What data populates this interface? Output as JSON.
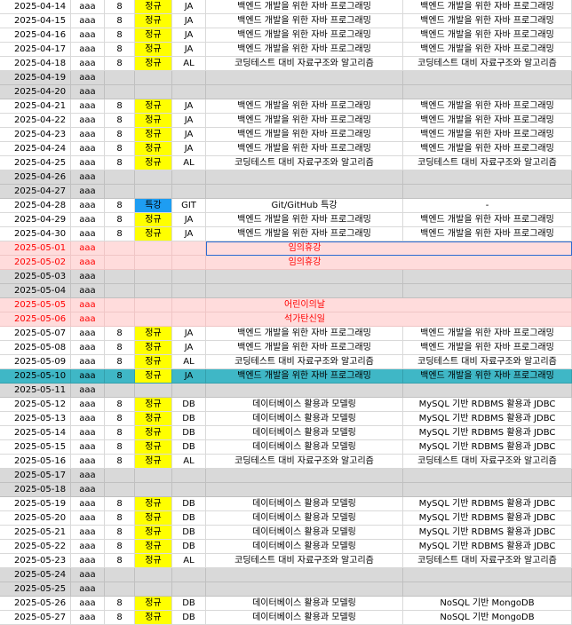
{
  "rows": [
    {
      "date": "2025-04-14",
      "user": "aaa",
      "num": "8",
      "type": "정규",
      "code": "JA",
      "subject": "백엔드 개발을 위한 자바 프로그래밍",
      "detail": "백엔드 개발을 위한 자바 프로그래밍",
      "style": "normal"
    },
    {
      "date": "2025-04-15",
      "user": "aaa",
      "num": "8",
      "type": "정규",
      "code": "JA",
      "subject": "백엔드 개발을 위한 자바 프로그래밍",
      "detail": "백엔드 개발을 위한 자바 프로그래밍",
      "style": "normal"
    },
    {
      "date": "2025-04-16",
      "user": "aaa",
      "num": "8",
      "type": "정규",
      "code": "JA",
      "subject": "백엔드 개발을 위한 자바 프로그래밍",
      "detail": "백엔드 개발을 위한 자바 프로그래밍",
      "style": "normal"
    },
    {
      "date": "2025-04-17",
      "user": "aaa",
      "num": "8",
      "type": "정규",
      "code": "JA",
      "subject": "백엔드 개발을 위한 자바 프로그래밍",
      "detail": "백엔드 개발을 위한 자바 프로그래밍",
      "style": "normal"
    },
    {
      "date": "2025-04-18",
      "user": "aaa",
      "num": "8",
      "type": "정규",
      "code": "AL",
      "subject": "코딩테스트 대비 자료구조와 알고리즘",
      "detail": "코딩테스트 대비 자료구조와 알고리즘",
      "style": "normal"
    },
    {
      "date": "2025-04-19",
      "user": "aaa",
      "num": "",
      "type": "",
      "code": "",
      "subject": "",
      "detail": "",
      "style": "gray"
    },
    {
      "date": "2025-04-20",
      "user": "aaa",
      "num": "",
      "type": "",
      "code": "",
      "subject": "",
      "detail": "",
      "style": "gray"
    },
    {
      "date": "2025-04-21",
      "user": "aaa",
      "num": "8",
      "type": "정규",
      "code": "JA",
      "subject": "백엔드 개발을 위한 자바 프로그래밍",
      "detail": "백엔드 개발을 위한 자바 프로그래밍",
      "style": "normal"
    },
    {
      "date": "2025-04-22",
      "user": "aaa",
      "num": "8",
      "type": "정규",
      "code": "JA",
      "subject": "백엔드 개발을 위한 자바 프로그래밍",
      "detail": "백엔드 개발을 위한 자바 프로그래밍",
      "style": "normal"
    },
    {
      "date": "2025-04-23",
      "user": "aaa",
      "num": "8",
      "type": "정규",
      "code": "JA",
      "subject": "백엔드 개발을 위한 자바 프로그래밍",
      "detail": "백엔드 개발을 위한 자바 프로그래밍",
      "style": "normal"
    },
    {
      "date": "2025-04-24",
      "user": "aaa",
      "num": "8",
      "type": "정규",
      "code": "JA",
      "subject": "백엔드 개발을 위한 자바 프로그래밍",
      "detail": "백엔드 개발을 위한 자바 프로그래밍",
      "style": "normal"
    },
    {
      "date": "2025-04-25",
      "user": "aaa",
      "num": "8",
      "type": "정규",
      "code": "AL",
      "subject": "코딩테스트 대비 자료구조와 알고리즘",
      "detail": "코딩테스트 대비 자료구조와 알고리즘",
      "style": "normal"
    },
    {
      "date": "2025-04-26",
      "user": "aaa",
      "num": "",
      "type": "",
      "code": "",
      "subject": "",
      "detail": "",
      "style": "gray"
    },
    {
      "date": "2025-04-27",
      "user": "aaa",
      "num": "",
      "type": "",
      "code": "",
      "subject": "",
      "detail": "",
      "style": "gray"
    },
    {
      "date": "2025-04-28",
      "user": "aaa",
      "num": "8",
      "type": "특강",
      "code": "GIT",
      "subject": "Git/GitHub 특강",
      "detail": "-",
      "style": "special"
    },
    {
      "date": "2025-04-29",
      "user": "aaa",
      "num": "8",
      "type": "정규",
      "code": "JA",
      "subject": "백엔드 개발을 위한 자바 프로그래밍",
      "detail": "백엔드 개발을 위한 자바 프로그래밍",
      "style": "normal"
    },
    {
      "date": "2025-04-30",
      "user": "aaa",
      "num": "8",
      "type": "정규",
      "code": "JA",
      "subject": "백엔드 개발을 위한 자바 프로그래밍",
      "detail": "백엔드 개발을 위한 자바 프로그래밍",
      "style": "normal"
    },
    {
      "date": "2025-05-01",
      "user": "aaa",
      "num": "",
      "type": "",
      "code": "",
      "subject": "임의휴강",
      "detail": "",
      "style": "pink",
      "selected": true
    },
    {
      "date": "2025-05-02",
      "user": "aaa",
      "num": "",
      "type": "",
      "code": "",
      "subject": "임의휴강",
      "detail": "",
      "style": "pink"
    },
    {
      "date": "2025-05-03",
      "user": "aaa",
      "num": "",
      "type": "",
      "code": "",
      "subject": "",
      "detail": "",
      "style": "gray"
    },
    {
      "date": "2025-05-04",
      "user": "aaa",
      "num": "",
      "type": "",
      "code": "",
      "subject": "",
      "detail": "",
      "style": "gray"
    },
    {
      "date": "2025-05-05",
      "user": "aaa",
      "num": "",
      "type": "",
      "code": "",
      "subject": "어린이의날",
      "detail": "",
      "style": "pink"
    },
    {
      "date": "2025-05-06",
      "user": "aaa",
      "num": "",
      "type": "",
      "code": "",
      "subject": "석가탄신일",
      "detail": "",
      "style": "pink"
    },
    {
      "date": "2025-05-07",
      "user": "aaa",
      "num": "8",
      "type": "정규",
      "code": "JA",
      "subject": "백엔드 개발을 위한 자바 프로그래밍",
      "detail": "백엔드 개발을 위한 자바 프로그래밍",
      "style": "normal"
    },
    {
      "date": "2025-05-08",
      "user": "aaa",
      "num": "8",
      "type": "정규",
      "code": "JA",
      "subject": "백엔드 개발을 위한 자바 프로그래밍",
      "detail": "백엔드 개발을 위한 자바 프로그래밍",
      "style": "normal"
    },
    {
      "date": "2025-05-09",
      "user": "aaa",
      "num": "8",
      "type": "정규",
      "code": "AL",
      "subject": "코딩테스트 대비 자료구조와 알고리즘",
      "detail": "코딩테스트 대비 자료구조와 알고리즘",
      "style": "normal"
    },
    {
      "date": "2025-05-10",
      "user": "aaa",
      "num": "8",
      "type": "정규",
      "code": "JA",
      "subject": "백엔드 개발을 위한 자바 프로그래밍",
      "detail": "백엔드 개발을 위한 자바 프로그래밍",
      "style": "cyan"
    },
    {
      "date": "2025-05-11",
      "user": "aaa",
      "num": "",
      "type": "",
      "code": "",
      "subject": "",
      "detail": "",
      "style": "gray"
    },
    {
      "date": "2025-05-12",
      "user": "aaa",
      "num": "8",
      "type": "정규",
      "code": "DB",
      "subject": "데이터베이스 활용과 모델링",
      "detail": "MySQL 기반 RDBMS 활용과 JDBC",
      "style": "normal"
    },
    {
      "date": "2025-05-13",
      "user": "aaa",
      "num": "8",
      "type": "정규",
      "code": "DB",
      "subject": "데이터베이스 활용과 모델링",
      "detail": "MySQL 기반 RDBMS 활용과 JDBC",
      "style": "normal"
    },
    {
      "date": "2025-05-14",
      "user": "aaa",
      "num": "8",
      "type": "정규",
      "code": "DB",
      "subject": "데이터베이스 활용과 모델링",
      "detail": "MySQL 기반 RDBMS 활용과 JDBC",
      "style": "normal"
    },
    {
      "date": "2025-05-15",
      "user": "aaa",
      "num": "8",
      "type": "정규",
      "code": "DB",
      "subject": "데이터베이스 활용과 모델링",
      "detail": "MySQL 기반 RDBMS 활용과 JDBC",
      "style": "normal"
    },
    {
      "date": "2025-05-16",
      "user": "aaa",
      "num": "8",
      "type": "정규",
      "code": "AL",
      "subject": "코딩테스트 대비 자료구조와 알고리즘",
      "detail": "코딩테스트 대비 자료구조와 알고리즘",
      "style": "normal"
    },
    {
      "date": "2025-05-17",
      "user": "aaa",
      "num": "",
      "type": "",
      "code": "",
      "subject": "",
      "detail": "",
      "style": "gray"
    },
    {
      "date": "2025-05-18",
      "user": "aaa",
      "num": "",
      "type": "",
      "code": "",
      "subject": "",
      "detail": "",
      "style": "gray"
    },
    {
      "date": "2025-05-19",
      "user": "aaa",
      "num": "8",
      "type": "정규",
      "code": "DB",
      "subject": "데이터베이스 활용과 모델링",
      "detail": "MySQL 기반 RDBMS 활용과 JDBC",
      "style": "normal"
    },
    {
      "date": "2025-05-20",
      "user": "aaa",
      "num": "8",
      "type": "정규",
      "code": "DB",
      "subject": "데이터베이스 활용과 모델링",
      "detail": "MySQL 기반 RDBMS 활용과 JDBC",
      "style": "normal"
    },
    {
      "date": "2025-05-21",
      "user": "aaa",
      "num": "8",
      "type": "정규",
      "code": "DB",
      "subject": "데이터베이스 활용과 모델링",
      "detail": "MySQL 기반 RDBMS 활용과 JDBC",
      "style": "normal"
    },
    {
      "date": "2025-05-22",
      "user": "aaa",
      "num": "8",
      "type": "정규",
      "code": "DB",
      "subject": "데이터베이스 활용과 모델링",
      "detail": "MySQL 기반 RDBMS 활용과 JDBC",
      "style": "normal"
    },
    {
      "date": "2025-05-23",
      "user": "aaa",
      "num": "8",
      "type": "정규",
      "code": "AL",
      "subject": "코딩테스트 대비 자료구조와 알고리즘",
      "detail": "코딩테스트 대비 자료구조와 알고리즘",
      "style": "normal"
    },
    {
      "date": "2025-05-24",
      "user": "aaa",
      "num": "",
      "type": "",
      "code": "",
      "subject": "",
      "detail": "",
      "style": "gray"
    },
    {
      "date": "2025-05-25",
      "user": "aaa",
      "num": "",
      "type": "",
      "code": "",
      "subject": "",
      "detail": "",
      "style": "gray"
    },
    {
      "date": "2025-05-26",
      "user": "aaa",
      "num": "8",
      "type": "정규",
      "code": "DB",
      "subject": "데이터베이스 활용과 모델링",
      "detail": "NoSQL 기반 MongoDB",
      "style": "normal"
    },
    {
      "date": "2025-05-27",
      "user": "aaa",
      "num": "8",
      "type": "정규",
      "code": "DB",
      "subject": "데이터베이스 활용과 모델링",
      "detail": "NoSQL 기반 MongoDB",
      "style": "normal"
    }
  ],
  "colors": {
    "weekend_gray": "#d9d9d9",
    "holiday_pink": "#ffdcdc",
    "holiday_text": "#ff0000",
    "regular_yellow": "#ffff00",
    "special_blue": "#1e9df2",
    "highlight_cyan": "#3fb7c6",
    "selection_border": "#2b6bd1"
  }
}
